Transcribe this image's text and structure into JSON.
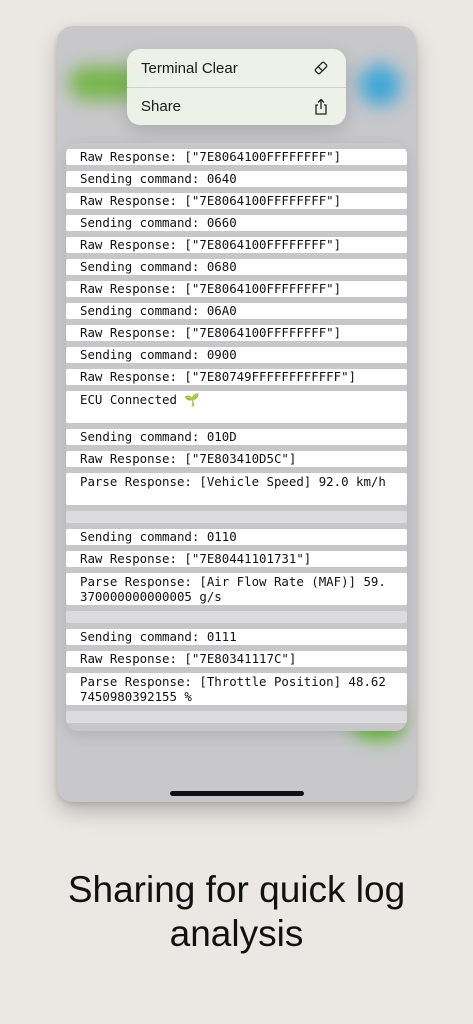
{
  "context_menu": {
    "items": [
      {
        "label": "Terminal Clear",
        "icon": "eraser-icon"
      },
      {
        "label": "Share",
        "icon": "share-icon"
      }
    ]
  },
  "log": [
    {
      "text": "Raw Response: [\"7E8064100FFFFFFFF\"]",
      "kind": "single"
    },
    {
      "text": "Sending command: 0640",
      "kind": "single"
    },
    {
      "text": "Raw Response: [\"7E8064100FFFFFFFF\"]",
      "kind": "single"
    },
    {
      "text": "Sending command: 0660",
      "kind": "single"
    },
    {
      "text": "Raw Response: [\"7E8064100FFFFFFFF\"]",
      "kind": "single"
    },
    {
      "text": "Sending command: 0680",
      "kind": "single"
    },
    {
      "text": "Raw Response: [\"7E8064100FFFFFFFF\"]",
      "kind": "single"
    },
    {
      "text": "Sending command: 06A0",
      "kind": "single"
    },
    {
      "text": "Raw Response: [\"7E8064100FFFFFFFF\"]",
      "kind": "single"
    },
    {
      "text": "Sending command: 0900",
      "kind": "single"
    },
    {
      "text": "Raw Response: [\"7E80749FFFFFFFFFFFF\"]",
      "kind": "single"
    },
    {
      "text": "ECU Connected 🌱",
      "kind": "ecu"
    },
    {
      "text": "Sending command: 010D",
      "kind": "single"
    },
    {
      "text": "Raw Response: [\"7E803410D5C\"]",
      "kind": "single"
    },
    {
      "text": "Parse Response: [Vehicle Speed] 92.0 km/h",
      "kind": "double"
    },
    {
      "text": "",
      "kind": "empty"
    },
    {
      "text": "Sending command: 0110",
      "kind": "single"
    },
    {
      "text": "Raw Response: [\"7E80441101731\"]",
      "kind": "single"
    },
    {
      "text": "Parse Response: [Air Flow Rate (MAF)] 59.370000000000005 g/s",
      "kind": "double"
    },
    {
      "text": "",
      "kind": "empty"
    },
    {
      "text": "Sending command: 0111",
      "kind": "single"
    },
    {
      "text": "Raw Response: [\"7E80341117C\"]",
      "kind": "single"
    },
    {
      "text": "Parse Response: [Throttle Position] 48.627450980392155 %",
      "kind": "double"
    },
    {
      "text": "",
      "kind": "empty"
    }
  ],
  "caption": {
    "line1": "Sharing for quick log",
    "line2": "analysis"
  }
}
